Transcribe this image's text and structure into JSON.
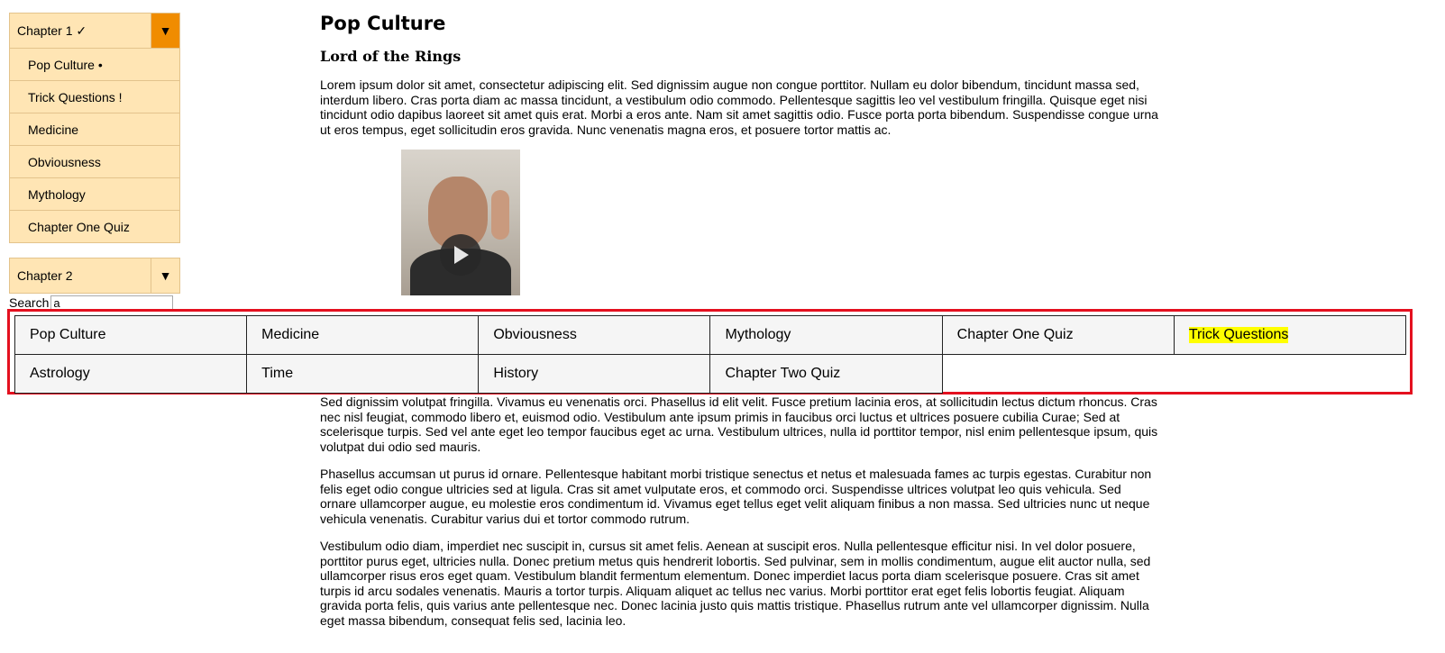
{
  "sidebar": {
    "chapter1": {
      "title": "Chapter 1 ✓",
      "toggle": "▼",
      "items": [
        {
          "label": "Pop Culture •"
        },
        {
          "label": "Trick Questions !"
        },
        {
          "label": "Medicine"
        },
        {
          "label": "Obviousness"
        },
        {
          "label": "Mythology"
        },
        {
          "label": "Chapter One Quiz"
        }
      ]
    },
    "chapter2": {
      "title": "Chapter 2",
      "toggle": "▼"
    },
    "search": {
      "label": "Search",
      "value": "a"
    }
  },
  "main": {
    "title": "Pop Culture",
    "section_title": "Lord of the Rings",
    "paragraphs_top": [
      "Lorem ipsum dolor sit amet, consectetur adipiscing elit. Sed dignissim augue non congue porttitor. Nullam eu dolor bibendum, tincidunt massa sed, interdum libero. Cras porta diam ac massa tincidunt, a vestibulum odio commodo. Pellentesque sagittis leo vel vestibulum fringilla. Quisque eget nisi tincidunt odio dapibus laoreet sit amet quis erat. Morbi a eros ante. Nam sit amet sagittis odio. Fusce porta porta bibendum. Suspendisse congue urna ut eros tempus, eget sollicitudin eros gravida. Nunc venenatis magna eros, et posuere tortor mattis ac."
    ],
    "paragraphs_bottom": [
      "Sed dignissim volutpat fringilla. Vivamus eu venenatis orci. Phasellus id elit velit. Fusce pretium lacinia eros, at sollicitudin lectus dictum rhoncus. Cras nec nisl feugiat, commodo libero et, euismod odio. Vestibulum ante ipsum primis in faucibus orci luctus et ultrices posuere cubilia Curae; Sed at scelerisque turpis. Sed vel ante eget leo tempor faucibus eget ac urna. Vestibulum ultrices, nulla id porttitor tempor, nisl enim pellentesque ipsum, quis volutpat dui odio sed mauris.",
      "Phasellus accumsan ut purus id ornare. Pellentesque habitant morbi tristique senectus et netus et malesuada fames ac turpis egestas. Curabitur non felis eget odio congue ultricies sed at ligula. Cras sit amet vulputate eros, et commodo orci. Suspendisse ultrices volutpat leo quis vehicula. Sed ornare ullamcorper augue, eu molestie eros condimentum id. Vivamus eget tellus eget velit aliquam finibus a non massa. Sed ultricies nunc ut neque vehicula venenatis. Curabitur varius dui et tortor commodo rutrum.",
      "Vestibulum odio diam, imperdiet nec suscipit in, cursus sit amet felis. Aenean at suscipit eros. Nulla pellentesque efficitur nisi. In vel dolor posuere, porttitor purus eget, ultricies nulla. Donec pretium metus quis hendrerit lobortis. Sed pulvinar, sem in mollis condimentum, augue elit auctor nulla, sed ullamcorper risus eros eget quam. Vestibulum blandit fermentum elementum. Donec imperdiet lacus porta diam scelerisque posuere. Cras sit amet turpis id arcu sodales venenatis. Mauris a tortor turpis. Aliquam aliquet ac tellus nec varius. Morbi porttitor erat eget felis lobortis feugiat. Aliquam gravida porta felis, quis varius ante pellentesque nec. Donec lacinia justo quis mattis tristique. Phasellus rutrum ante vel ullamcorper dignissim. Nulla eget massa bibendum, consequat felis sed, lacinia leo."
    ],
    "video": {
      "play_icon": "play-icon"
    }
  },
  "search_results": {
    "items": [
      {
        "label": "Pop Culture",
        "highlighted": false
      },
      {
        "label": "Medicine",
        "highlighted": false
      },
      {
        "label": "Obviousness",
        "highlighted": false
      },
      {
        "label": "Mythology",
        "highlighted": false
      },
      {
        "label": "Chapter One Quiz",
        "highlighted": false
      },
      {
        "label": "Trick Questions",
        "highlighted": true
      },
      {
        "label": "Astrology",
        "highlighted": false
      },
      {
        "label": "Time",
        "highlighted": false
      },
      {
        "label": "History",
        "highlighted": false
      },
      {
        "label": "Chapter Two Quiz",
        "highlighted": false
      }
    ],
    "highlight_color": "#ffff00",
    "border_color": "#e4101f"
  },
  "colors": {
    "sidebar_bg": "#ffe5b4",
    "toggle_active": "#f08c00"
  }
}
